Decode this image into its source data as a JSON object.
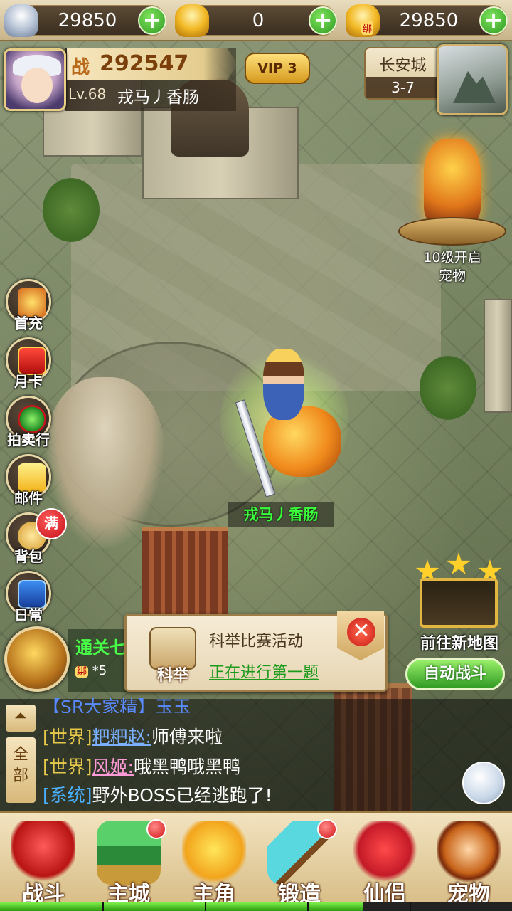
{
  "currency": {
    "silver": {
      "value": "29850",
      "icon": "silver-ingot-icon"
    },
    "gold": {
      "value": "0",
      "icon": "gold-ingot-icon"
    },
    "bound_gold": {
      "value": "29850",
      "icon": "bound-gold-icon",
      "tag": "绑"
    },
    "add_label": "+"
  },
  "player": {
    "power_icon": "战",
    "power": "292547",
    "level": "Lv.68",
    "name": "戎马丿香肠",
    "vip": "VIP 3",
    "field_name": "戎马丿香肠"
  },
  "map": {
    "city": "长安城",
    "stage": "3-7"
  },
  "pet_unlock": {
    "line1": "10级开启",
    "line2": "宠物"
  },
  "side_menu": [
    {
      "label": "首充",
      "icon": "gift-box-icon"
    },
    {
      "label": "月卡",
      "icon": "month-card-icon"
    },
    {
      "label": "拍卖行",
      "icon": "auction-icon"
    },
    {
      "label": "邮件",
      "icon": "mail-icon"
    },
    {
      "label": "背包",
      "icon": "bag-icon",
      "badge": "满"
    },
    {
      "label": "日常",
      "icon": "daily-book-icon"
    }
  ],
  "clear_reward": {
    "title": "通关七",
    "reward_tag": "绑",
    "reward": "*5"
  },
  "exam": {
    "icon_label": "科举",
    "title": "科举比赛活动",
    "status": "正在进行第一题",
    "close": "✕"
  },
  "right": {
    "new_map_label": "前往新地图",
    "auto_fight_label": "自动战斗"
  },
  "chat": {
    "collapse": "⏶",
    "channel": "全部",
    "cut_line": "【SR大家精】玉玉",
    "lines": [
      {
        "channel": "[世界]",
        "nick": "粑粑赵:",
        "msg": "师傅来啦"
      },
      {
        "channel": "[世界]",
        "nick": "风姬:",
        "msg": "哦黑鸭哦黑鸭"
      },
      {
        "channel": "[系统]",
        "msg": "野外BOSS已经逃跑了!"
      }
    ]
  },
  "bottom_nav": [
    {
      "label": "战斗",
      "icon": "fight-icon",
      "dot": false
    },
    {
      "label": "主城",
      "icon": "main-city-icon",
      "dot": true
    },
    {
      "label": "主角",
      "icon": "hero-icon",
      "dot": false
    },
    {
      "label": "锻造",
      "icon": "forge-hammer-icon",
      "dot": true
    },
    {
      "label": "仙侣",
      "icon": "companion-heart-icon",
      "dot": false
    },
    {
      "label": "宠物",
      "icon": "pet-monkey-icon",
      "dot": false
    }
  ],
  "exp_progress": 0.71
}
